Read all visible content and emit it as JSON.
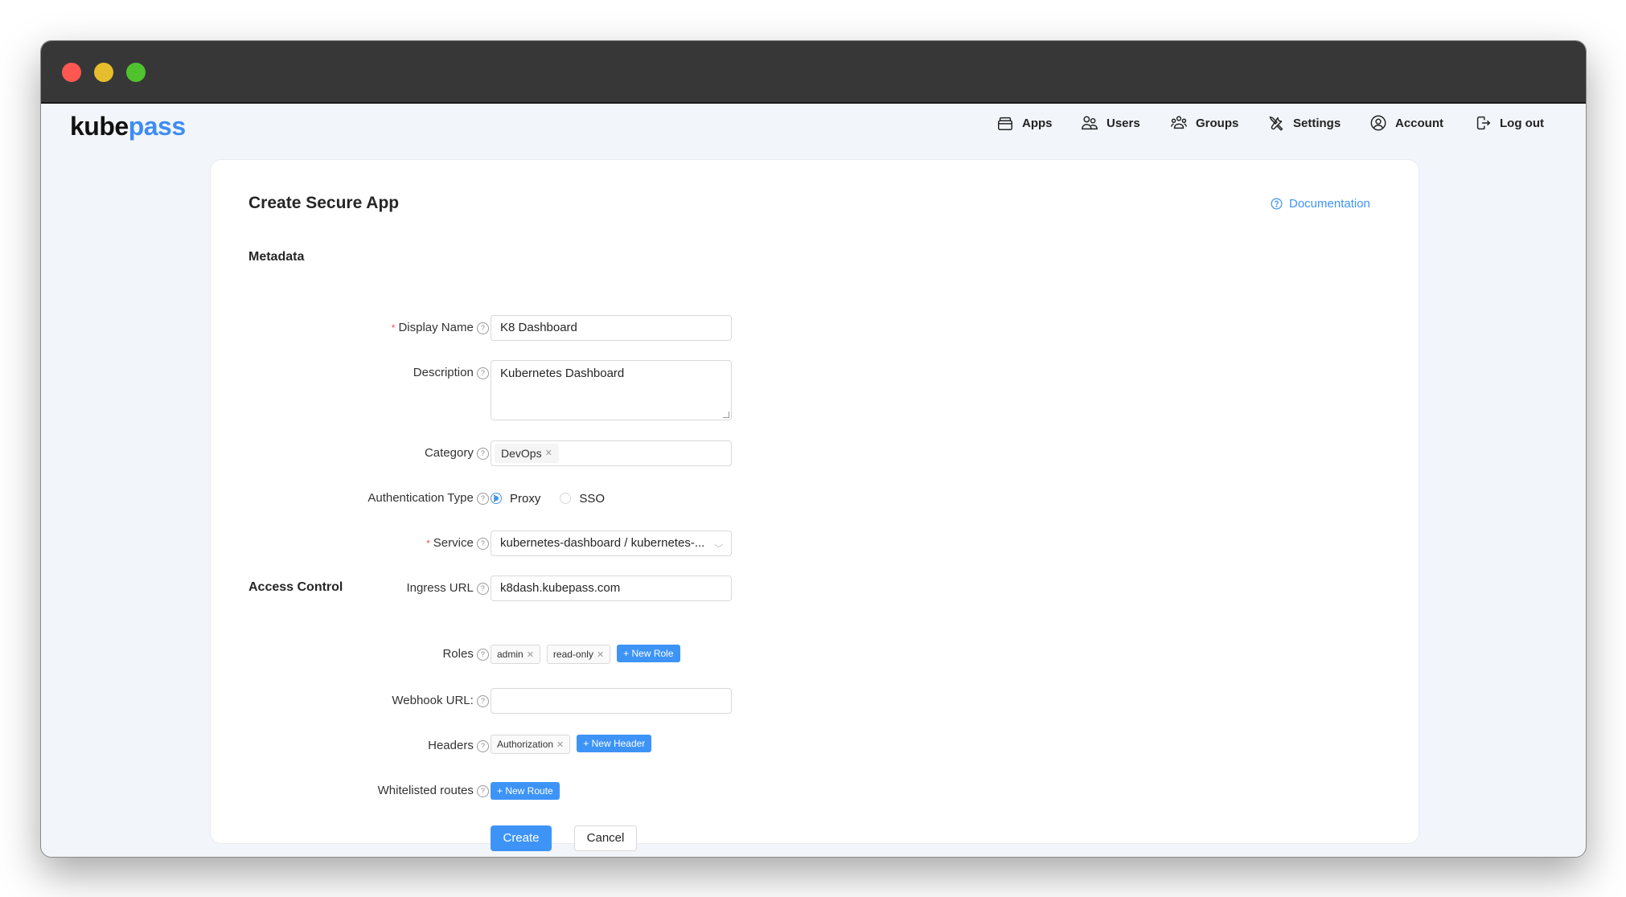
{
  "window": {
    "controls": [
      "close",
      "minimize",
      "maximize"
    ]
  },
  "brand": {
    "part1": "kube",
    "part2": "pass"
  },
  "nav": [
    {
      "label": "Apps",
      "icon": "apps-icon"
    },
    {
      "label": "Users",
      "icon": "users-icon"
    },
    {
      "label": "Groups",
      "icon": "groups-icon"
    },
    {
      "label": "Settings",
      "icon": "settings-icon"
    },
    {
      "label": "Account",
      "icon": "account-icon"
    },
    {
      "label": "Log out",
      "icon": "logout-icon"
    }
  ],
  "page": {
    "title": "Create Secure App",
    "documentation": "Documentation"
  },
  "sections": {
    "metadata": "Metadata",
    "access_control": "Access Control"
  },
  "form": {
    "display_name": {
      "label": "Display Name",
      "required": true,
      "value": "K8 Dashboard"
    },
    "description": {
      "label": "Description",
      "value": "Kubernetes Dashboard"
    },
    "category": {
      "label": "Category",
      "tags": [
        "DevOps"
      ]
    },
    "auth_type": {
      "label": "Authentication Type",
      "options": [
        "Proxy",
        "SSO"
      ],
      "selected": "Proxy"
    },
    "service": {
      "label": "Service",
      "required": true,
      "value": "kubernetes-dashboard / kubernetes-..."
    },
    "ingress_url": {
      "label": "Ingress URL",
      "value": "k8dash.kubepass.com"
    },
    "roles": {
      "label": "Roles",
      "tags": [
        "admin",
        "read-only"
      ],
      "add_label": "+ New Role"
    },
    "webhook_url": {
      "label": "Webhook URL:",
      "value": ""
    },
    "headers": {
      "label": "Headers",
      "tags": [
        "Authorization"
      ],
      "add_label": "+ New Header"
    },
    "whitelisted_routes": {
      "label": "Whitelisted routes",
      "tags": [],
      "add_label": "+ New Route"
    }
  },
  "actions": {
    "create": "Create",
    "cancel": "Cancel"
  },
  "colors": {
    "accent": "#3d94f6",
    "required": "#ff4d4f",
    "brand_blue": "#3f8cf3"
  }
}
